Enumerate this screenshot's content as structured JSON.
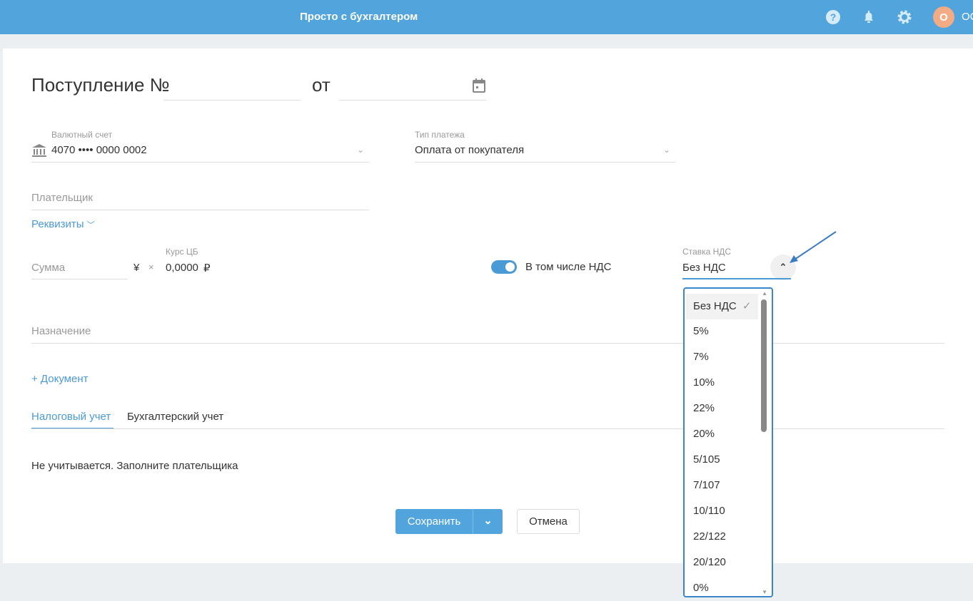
{
  "header": {
    "title": "Просто с бухгалтером",
    "avatar_letter": "O",
    "user_text": "OC"
  },
  "form": {
    "title": "Поступление №",
    "number_value": "",
    "date_label": "от",
    "date_value": "",
    "account": {
      "label": "Валютный счет",
      "value": "4070 •••• 0000 0002"
    },
    "payment_type": {
      "label": "Тип платежа",
      "value": "Оплата от покупателя"
    },
    "payer": {
      "placeholder": "Плательщик"
    },
    "requisites_link": "Реквизиты",
    "amount": {
      "placeholder": "Сумма",
      "currency": "¥",
      "times": "×"
    },
    "rate": {
      "label": "Курс ЦБ",
      "value": "0,0000",
      "currency": "₽"
    },
    "vat_toggle": {
      "label": "В том числе НДС",
      "on": true
    },
    "vat_rate": {
      "label": "Ставка НДС",
      "value": "Без НДС"
    },
    "purpose": {
      "placeholder": "Назначение"
    },
    "add_document": "+ Документ",
    "tabs": [
      {
        "label": "Налоговый учет",
        "active": true
      },
      {
        "label": "Бухгалтерский учет",
        "active": false
      }
    ],
    "tab_message": "Не учитывается. Заполните плательщика",
    "save": "Сохранить",
    "cancel": "Отмена"
  },
  "vat_options": [
    "Без НДС",
    "5%",
    "7%",
    "10%",
    "22%",
    "20%",
    "5/105",
    "7/107",
    "10/110",
    "22/122",
    "20/120",
    "0%"
  ],
  "selected_vat": "Без НДС",
  "colors": {
    "header": "#52a5dc",
    "accent": "#4a9ad6",
    "avatar": "#f2ab84"
  }
}
